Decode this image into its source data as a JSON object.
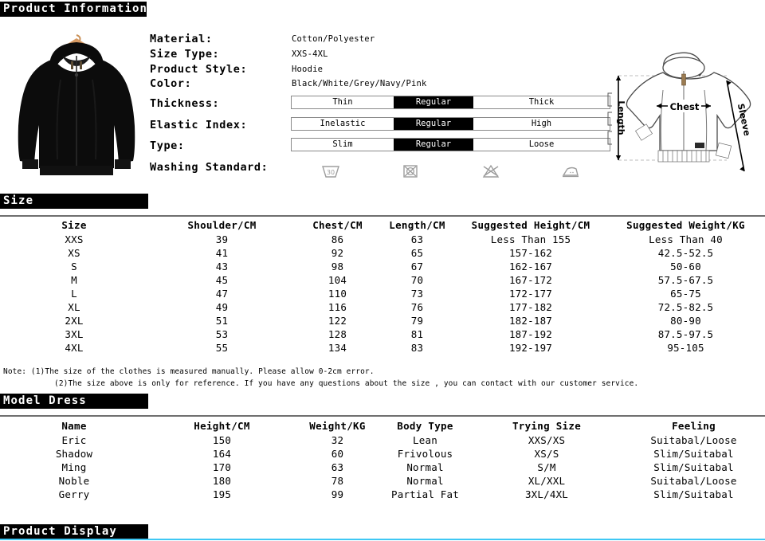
{
  "sections": {
    "product_information": "Product Information",
    "size": "Size",
    "model_dress": "Model Dress",
    "product_display": "Product Display"
  },
  "specs": {
    "simple": [
      {
        "label": "Material:",
        "value": "Cotton/Polyester"
      },
      {
        "label": "Size Type:",
        "value": "XXS-4XL"
      },
      {
        "label": "Product Style:",
        "value": "Hoodie"
      },
      {
        "label": "Color:",
        "value": "Black/White/Grey/Navy/Pink"
      }
    ],
    "options": [
      {
        "label": "Thickness:",
        "choices": [
          "Thin",
          "Regular",
          "Thick"
        ],
        "selected": 1
      },
      {
        "label": "Elastic Index:",
        "choices": [
          "Inelastic",
          "Regular",
          "High"
        ],
        "selected": 1
      },
      {
        "label": "Type:",
        "choices": [
          "Slim",
          "Regular",
          "Loose"
        ],
        "selected": 1
      }
    ],
    "washing_label": "Washing Standard:",
    "washing_icons": [
      "wash-30-icon",
      "do-not-tumble-dry-icon",
      "do-not-bleach-icon",
      "iron-icon"
    ]
  },
  "diagram": {
    "labels": {
      "length": "Length",
      "chest": "Chest",
      "sleeve": "Sleeve"
    }
  },
  "size_table": {
    "headers": [
      "Size",
      "Shoulder/CM",
      "Chest/CM",
      "Length/CM",
      "Suggested Height/CM",
      "Suggested Weight/KG"
    ],
    "rows": [
      [
        "XXS",
        "39",
        "86",
        "63",
        "Less Than 155",
        "Less Than 40"
      ],
      [
        "XS",
        "41",
        "92",
        "65",
        "157-162",
        "42.5-52.5"
      ],
      [
        "S",
        "43",
        "98",
        "67",
        "162-167",
        "50-60"
      ],
      [
        "M",
        "45",
        "104",
        "70",
        "167-172",
        "57.5-67.5"
      ],
      [
        "L",
        "47",
        "110",
        "73",
        "172-177",
        "65-75"
      ],
      [
        "XL",
        "49",
        "116",
        "76",
        "177-182",
        "72.5-82.5"
      ],
      [
        "2XL",
        "51",
        "122",
        "79",
        "182-187",
        "80-90"
      ],
      [
        "3XL",
        "53",
        "128",
        "81",
        "187-192",
        "87.5-97.5"
      ],
      [
        "4XL",
        "55",
        "134",
        "83",
        "192-197",
        "95-105"
      ]
    ],
    "note_line1": "Note: (1)The size of the clothes is measured manually. Please allow 0-2cm error.",
    "note_line2": "(2)The size above is only for reference. If you have any questions about the size , you can contact with our customer service."
  },
  "model_table": {
    "headers": [
      "Name",
      "Height/CM",
      "Weight/KG",
      "Body Type",
      "Trying Size",
      "Feeling"
    ],
    "rows": [
      [
        "Eric",
        "150",
        "32",
        "Lean",
        "XXS/XS",
        "Suitabal/Loose"
      ],
      [
        "Shadow",
        "164",
        "60",
        "Frivolous",
        "XS/S",
        "Slim/Suitabal"
      ],
      [
        "Ming",
        "170",
        "63",
        "Normal",
        "S/M",
        "Slim/Suitabal"
      ],
      [
        "Noble",
        "180",
        "78",
        "Normal",
        "XL/XXL",
        "Suitabal/Loose"
      ],
      [
        "Gerry",
        "195",
        "99",
        "Partial Fat",
        "3XL/4XL",
        "Slim/Suitabal"
      ]
    ]
  },
  "colors": {
    "bar_background": "#000000",
    "bar_text": "#ffffff",
    "accent_line": "#3fc8f4",
    "rule": "#6f6f6f"
  }
}
